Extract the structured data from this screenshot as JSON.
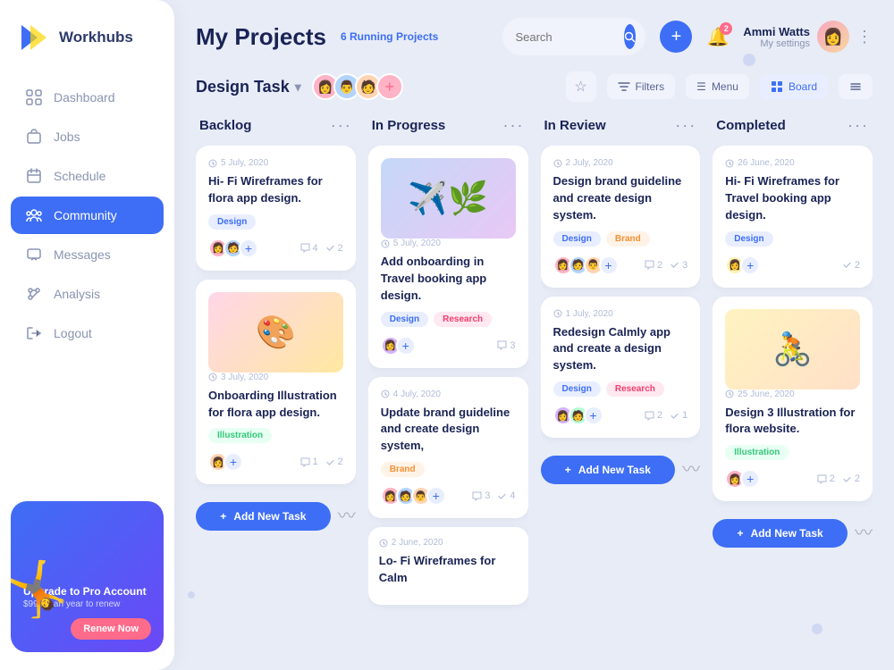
{
  "app": {
    "name": "Workhubs"
  },
  "header": {
    "title": "My Projects",
    "running": "6 Running Projects",
    "search_placeholder": "Search",
    "user": {
      "name": "Ammi Watts",
      "role": "My settings"
    },
    "notif_count": "2"
  },
  "project": {
    "name": "Design Task",
    "filters_label": "Filters",
    "menu_label": "Menu",
    "board_label": "Board"
  },
  "columns": [
    {
      "id": "backlog",
      "title": "Backlog",
      "cards": [
        {
          "date": "5 July, 2020",
          "title": "Hi- Fi Wireframes for flora app design.",
          "tags": [
            "Design"
          ],
          "comments": "4",
          "tasks": "2",
          "avatars": [
            "🧑",
            "👩"
          ]
        },
        {
          "date": "3 July, 2020",
          "title": "Onboarding Illustration for flora app design.",
          "tags": [
            "Illustration"
          ],
          "comments": "1",
          "tasks": "2",
          "avatars": [
            "👩",
            "🧑"
          ],
          "has_illustration": "pink"
        }
      ],
      "add_label": "Add New Task"
    },
    {
      "id": "inprogress",
      "title": "In Progress",
      "cards": [
        {
          "date": "5 July, 2020",
          "title": "Add onboarding in Travel booking app design.",
          "tags": [
            "Design",
            "Research"
          ],
          "comments": "3",
          "tasks": "",
          "avatars": [
            "👩"
          ],
          "has_illustration": "travel"
        },
        {
          "date": "4 July, 2020",
          "title": "Update brand guideline and create design system,",
          "tags": [
            "Brand"
          ],
          "comments": "3",
          "tasks": "4",
          "avatars": [
            "👩",
            "🧑",
            "👨"
          ]
        },
        {
          "date": "2 June, 2020",
          "title": "Lo- Fi Wireframes for Calm",
          "tags": [],
          "comments": "",
          "tasks": "",
          "avatars": []
        }
      ],
      "add_label": "Add New Task"
    },
    {
      "id": "inreview",
      "title": "In Review",
      "cards": [
        {
          "date": "2 July, 2020",
          "title": "Design brand guideline and create design system.",
          "tags": [
            "Design",
            "Brand"
          ],
          "comments": "2",
          "tasks": "3",
          "avatars": [
            "👩",
            "🧑",
            "👨"
          ]
        },
        {
          "date": "1 July, 2020",
          "title": "Redesign Calmly app and create a design system.",
          "tags": [
            "Design",
            "Research"
          ],
          "comments": "2",
          "tasks": "1",
          "avatars": [
            "👩",
            "🧑"
          ]
        }
      ],
      "add_label": "Add New Task"
    },
    {
      "id": "completed",
      "title": "Completed",
      "cards": [
        {
          "date": "26 June, 2020",
          "title": "Hi- Fi Wireframes for Travel booking app design.",
          "tags": [
            "Design"
          ],
          "comments": "",
          "tasks": "2",
          "avatars": [
            "👩",
            "🧑"
          ]
        },
        {
          "date": "25 June, 2020",
          "title": "Design 3 Illustration for flora website.",
          "tags": [
            "Illustration"
          ],
          "comments": "2",
          "tasks": "2",
          "avatars": [
            "👩",
            "🧑"
          ],
          "has_illustration": "yellow"
        }
      ],
      "add_label": "Add New Task"
    }
  ],
  "nav": {
    "items": [
      {
        "label": "Dashboard",
        "icon": "⚙"
      },
      {
        "label": "Jobs",
        "icon": "💼"
      },
      {
        "label": "Schedule",
        "icon": "📅"
      },
      {
        "label": "Community",
        "icon": "👥",
        "active": true
      },
      {
        "label": "Messages",
        "icon": "💬"
      },
      {
        "label": "Analysis",
        "icon": "📊"
      },
      {
        "label": "Logout",
        "icon": "🚪"
      }
    ]
  },
  "promo": {
    "title": "Upgrade to Pro Account",
    "subtitle": "$99 for an year to renew",
    "btn_label": "Renew Now"
  }
}
